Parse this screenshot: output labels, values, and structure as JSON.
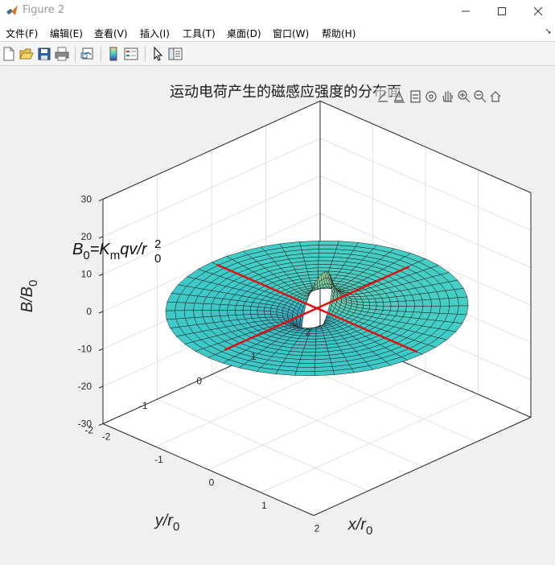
{
  "window": {
    "title": "Figure 2"
  },
  "menu": [
    {
      "label": "文件(F)"
    },
    {
      "label": "编辑(E)"
    },
    {
      "label": "查看(V)"
    },
    {
      "label": "插入(I)"
    },
    {
      "label": "工具(T)"
    },
    {
      "label": "桌面(D)"
    },
    {
      "label": "窗口(W)"
    },
    {
      "label": "帮助(H)"
    }
  ],
  "toolbar": [
    "new-figure-icon",
    "open-file-icon",
    "save-icon",
    "print-icon",
    "link-plot-icon",
    "insert-colorbar-icon",
    "insert-legend-icon",
    "edit-plot-cursor-icon",
    "property-inspector-icon"
  ],
  "axes_toolbar": [
    "brush-icon",
    "data-tips-icon",
    "export-icon",
    "rotate-3d-icon",
    "pan-hand-icon",
    "zoom-in-icon",
    "zoom-out-icon",
    "home-icon"
  ],
  "plot": {
    "title": "运动电荷产生的磁感应强度的分布面",
    "annotation": {
      "base": "B",
      "sub1": "0",
      "eq": "=K",
      "sub2": "m",
      "mid": "qv/r",
      "sub3": "0",
      "sup3": "2"
    },
    "zlabel": {
      "base": "B/B",
      "sub": "0"
    },
    "xlabel": {
      "base": "x/r",
      "sub": "0"
    },
    "ylabel": {
      "base": "y/r",
      "sub": "0"
    },
    "zticks": [
      "30",
      "20",
      "10",
      "0",
      "-10",
      "-20",
      "-30"
    ],
    "xticks": [
      "-2",
      "-1",
      "0",
      "1",
      "2"
    ],
    "yticks": [
      "-2",
      "-1",
      "0",
      "1",
      "2"
    ],
    "surface_colors": {
      "flat": "#3ecdc8",
      "peak": "#f5e27a",
      "trough": "#3b3bb8",
      "velocity_line": "#e01010"
    }
  },
  "chart_data": {
    "type": "surface",
    "title": "运动电荷产生的磁感应强度的分布面",
    "xlabel": "x/r0",
    "ylabel": "y/r0",
    "zlabel": "B/B0",
    "xlim": [
      -2,
      2
    ],
    "ylim": [
      -2,
      2
    ],
    "zlim": [
      -30,
      30
    ],
    "annotation": "B0=Km qv/r0^2",
    "radial_range": [
      0.2,
      2
    ],
    "peak_z": 22,
    "trough_z": -28,
    "grid": true
  }
}
